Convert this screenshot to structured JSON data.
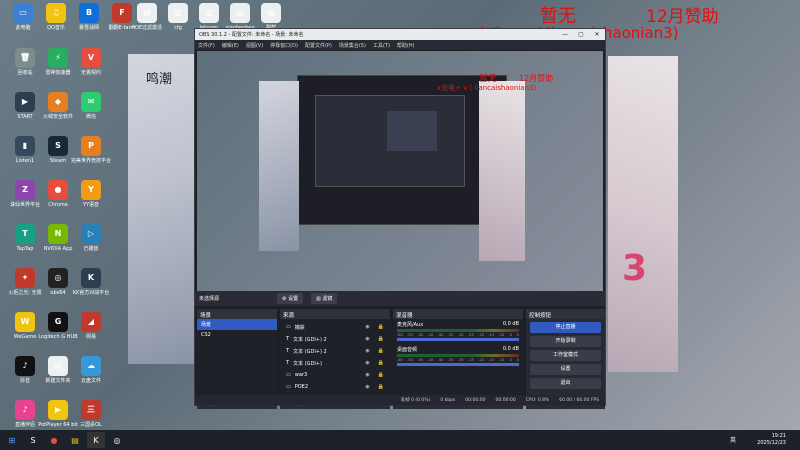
{
  "desktop": {
    "icons": [
      {
        "label": "此电脑",
        "glyph": "▭",
        "color": "#3b7fd1"
      },
      {
        "label": "QQ音乐",
        "glyph": "♫",
        "color": "#f1c40f"
      },
      {
        "label": "暴雪战网",
        "glyph": "B",
        "color": "#0f6fd6"
      },
      {
        "label": "翻翻E-farm",
        "glyph": "F",
        "color": "#c0392b"
      },
      {
        "label": "POE过滤激活",
        "glyph": "▤",
        "color": "#ecf0f1"
      },
      {
        "label": "cfg",
        "glyph": "▥",
        "color": "#ecf0f1"
      },
      {
        "label": "letsvpn",
        "glyph": "▥",
        "color": "#ecf0f1"
      },
      {
        "label": "xiaobenben",
        "glyph": "▤",
        "color": "#ecf0f1"
      },
      {
        "label": "裂帮",
        "glyph": "▤",
        "color": "#ecf0f1"
      },
      {
        "label": "回收站",
        "glyph": "🗑",
        "color": "#7f8c8d"
      },
      {
        "label": "雷神加速器",
        "glyph": "⚡",
        "color": "#27ae60"
      },
      {
        "label": "无畏契约",
        "glyph": "V",
        "color": "#e74c3c"
      },
      {
        "label": "START",
        "glyph": "▶",
        "color": "#2c3e50"
      },
      {
        "label": "火绒安全软件",
        "glyph": "◆",
        "color": "#e67e22"
      },
      {
        "label": "微信",
        "glyph": "✉",
        "color": "#2ecc71"
      },
      {
        "label": "Listen1",
        "glyph": "▮",
        "color": "#34495e"
      },
      {
        "label": "Steam",
        "glyph": "S",
        "color": "#1b2838"
      },
      {
        "label": "完美世界竞技平台",
        "glyph": "P",
        "color": "#e67e22"
      },
      {
        "label": "诛仙世界平台",
        "glyph": "Z",
        "color": "#8e44ad"
      },
      {
        "label": "Chrome",
        "glyph": "●",
        "color": "#e74c3c"
      },
      {
        "label": "YY语音",
        "glyph": "Y",
        "color": "#f39c12"
      },
      {
        "label": "TapTap",
        "glyph": "T",
        "color": "#16a085"
      },
      {
        "label": "NVIDIA App",
        "glyph": "N",
        "color": "#76b900"
      },
      {
        "label": "已播放",
        "glyph": "▷",
        "color": "#2980b9"
      },
      {
        "label": "火炬之光: 无限",
        "glyph": "✦",
        "color": "#c0392b"
      },
      {
        "label": "obs64",
        "glyph": "◎",
        "color": "#222222"
      },
      {
        "label": "KK官方对战平台",
        "glyph": "K",
        "color": "#2c3e50"
      },
      {
        "label": "WeGame",
        "glyph": "W",
        "color": "#f1c40f"
      },
      {
        "label": "Logitech G HUB",
        "glyph": "G",
        "color": "#111111"
      },
      {
        "label": "网易",
        "glyph": "◢",
        "color": "#c0392b"
      },
      {
        "label": "抖音",
        "glyph": "♪",
        "color": "#111111"
      },
      {
        "label": "新建文件夹",
        "glyph": "▤",
        "color": "#ecf0f1"
      },
      {
        "label": "云盘文件",
        "glyph": "☁",
        "color": "#3498db"
      },
      {
        "label": "直播伴侣",
        "glyph": "♪",
        "color": "#e84393"
      },
      {
        "label": "PotPlayer 64 bit",
        "glyph": "▶",
        "color": "#f1c40f"
      },
      {
        "label": "三国杀OL",
        "glyph": "三",
        "color": "#c0392b"
      },
      {
        "label": "MuMu模拟器12",
        "glyph": "M",
        "color": "#27ae60"
      },
      {
        "label": "UU加速器",
        "glyph": "U",
        "color": "#2980b9"
      }
    ]
  },
  "overlays": {
    "big_left": "暂无",
    "big_right": "12月赞助",
    "big_bottom": "x充电+ v ( liancaishaonian3)",
    "small_top": "暂无",
    "small_right": "12月赞助",
    "small_bottom": "x充电+ v ( liancaishaonian3)"
  },
  "wallpaper": {
    "chars": "鸣潮"
  },
  "obs": {
    "title": "OBS 30.1.2 - 配置文件: 未命名 - 场景: 未命名",
    "menu": [
      "文件(F)",
      "编辑(E)",
      "视图(V)",
      "停靠窗口(D)",
      "配置文件(P)",
      "场景集合(S)",
      "工具(T)",
      "帮助(H)"
    ],
    "preview_bar": {
      "scene_label": "未选择源",
      "settings_btn": "⚙ 设置",
      "filters_btn": "▥ 滤镜"
    },
    "scenes": {
      "title": "场景",
      "items": [
        "场景",
        "CS2"
      ],
      "active": 0
    },
    "sources": {
      "title": "来源",
      "items": [
        {
          "name": "捕获",
          "icon": "▭"
        },
        {
          "name": "文本 (GDI+) 2",
          "icon": "T"
        },
        {
          "name": "文本 (GDI+) 2",
          "icon": "T"
        },
        {
          "name": "文本 (GDI+)",
          "icon": "T"
        },
        {
          "name": "war3",
          "icon": "▭"
        },
        {
          "name": "POE2",
          "icon": "▭"
        }
      ]
    },
    "mixer": {
      "title": "混音器",
      "channels": [
        {
          "name": "麦克风/Aux",
          "db": "0.0 dB"
        },
        {
          "name": "桌面音频",
          "db": "0.0 dB"
        }
      ],
      "scale": [
        "-60",
        "-55",
        "-50",
        "-45",
        "-40",
        "-35",
        "-30",
        "-25",
        "-20",
        "-15",
        "-10",
        "-5",
        "0"
      ]
    },
    "controls": {
      "title": "控制按钮",
      "buttons": [
        "停止直播",
        "开始录制",
        "工作室模式",
        "设置",
        "退出"
      ]
    },
    "bottom_tabs": [
      "控制按钮",
      "转场动画"
    ],
    "status": {
      "dropped": "丢帧 0 (0.0%)",
      "bitrate": "0 kbps",
      "live_time": "00:00:00",
      "rec_time": "00:00:00",
      "cpu": "CPU: 0.8%",
      "fps": "60.00 / 60.00 FPS"
    }
  },
  "taskbar": {
    "time": "19:21",
    "date": "2025/12/23",
    "lang": "英"
  }
}
